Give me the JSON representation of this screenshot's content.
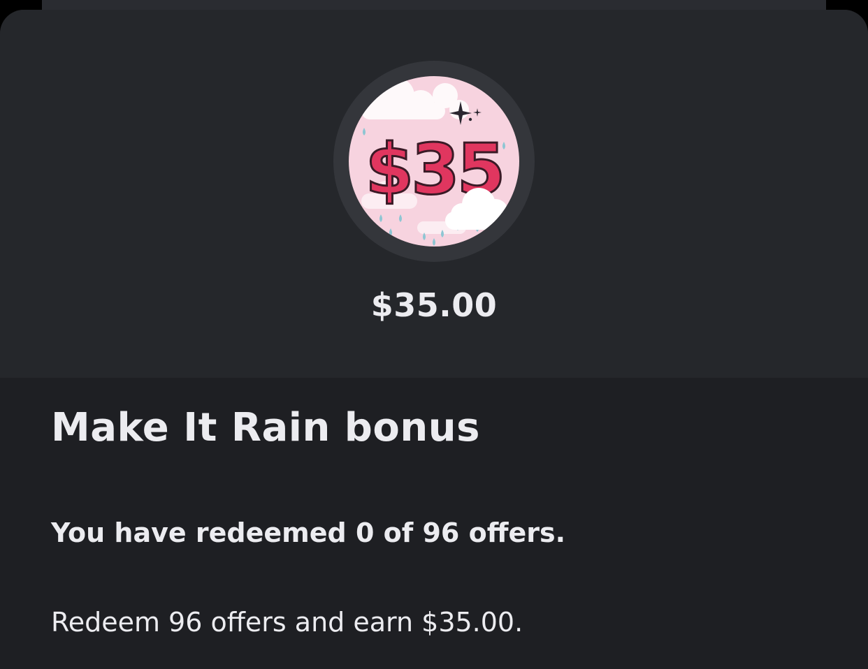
{
  "badge": {
    "image_text": "$35",
    "amount": "$35.00",
    "icon": "make-it-rain-badge-icon",
    "colors": {
      "background": "#f7d3df",
      "numerals": "#e0365f",
      "clouds": "#ffffff",
      "raindrops": "#8ec6d3",
      "sparkle": "#2a2730"
    }
  },
  "bonus": {
    "title": "Make It Rain bonus",
    "progress_text": "You have redeemed 0 of 96 offers.",
    "redeemed": 0,
    "required": 96,
    "description": "Redeem 96 offers and earn $35.00."
  },
  "theme": {
    "sheet_background": "#1e1f23",
    "header_background": "#25272b",
    "text": "#ececf0"
  }
}
